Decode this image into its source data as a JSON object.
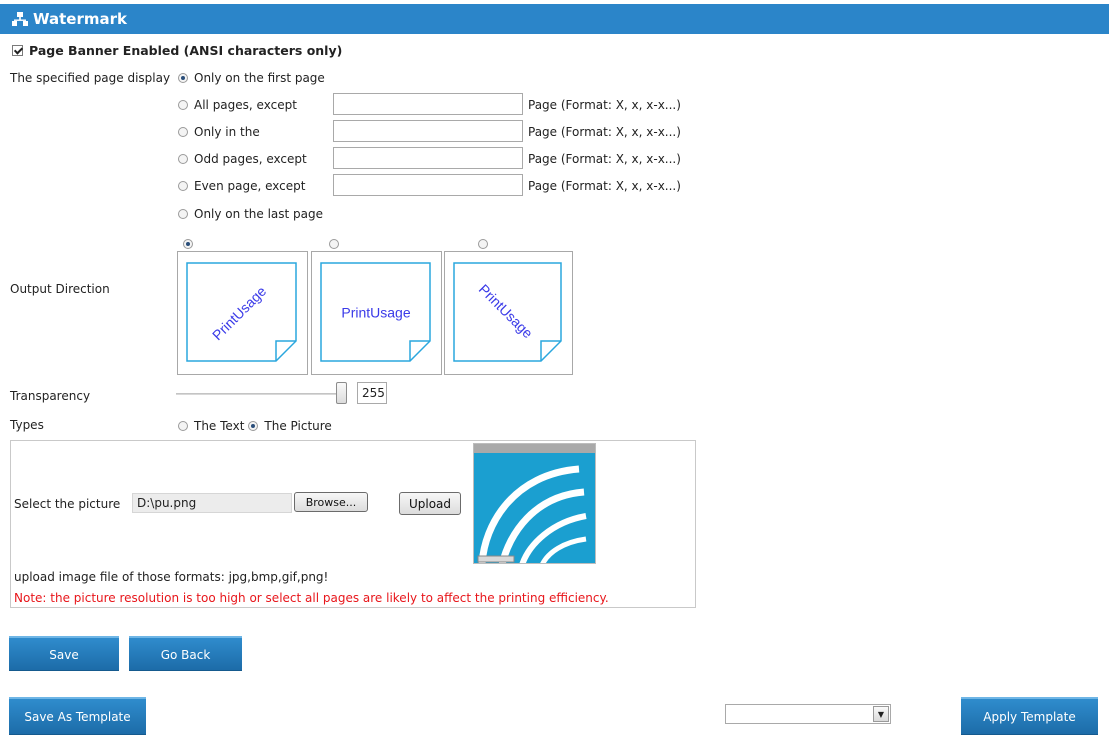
{
  "header": {
    "title": "Watermark",
    "icon": "network-icon",
    "bg_color": "#2b85c9"
  },
  "banner": {
    "label": "Page Banner Enabled (ANSI characters only)",
    "checked": true
  },
  "page_display": {
    "label": "The specified page display",
    "options": [
      {
        "label": "Only on the first page",
        "selected": true
      },
      {
        "label": "All pages, except",
        "input": "",
        "format": "Page (Format: X, x, x-x...)"
      },
      {
        "label": "Only in the",
        "input": "",
        "format": "Page (Format: X, x, x-x...)"
      },
      {
        "label": "Odd pages, except",
        "input": "",
        "format": "Page (Format: X, x, x-x...)"
      },
      {
        "label": "Even page, except",
        "input": "",
        "format": "Page (Format: X, x, x-x...)"
      },
      {
        "label": "Only on the last page"
      }
    ]
  },
  "output_direction": {
    "label": "Output Direction",
    "sample_text": "PrintUsage",
    "options": [
      {
        "orientation": "diagonal-up",
        "selected": true
      },
      {
        "orientation": "horizontal",
        "selected": false
      },
      {
        "orientation": "diagonal-down",
        "selected": false
      }
    ]
  },
  "transparency": {
    "label": "Transparency",
    "value": "255",
    "level": 1.0
  },
  "types": {
    "label": "Types",
    "options": [
      {
        "label": "The Text",
        "selected": false
      },
      {
        "label": "The Picture",
        "selected": true
      }
    ]
  },
  "picture": {
    "label": "Select the picture",
    "file_value": "D:\\pu.png",
    "browse_label": "Browse...",
    "upload_label": "Upload",
    "formats_text": "upload image file of those formats: jpg,bmp,gif,png!",
    "note_text": "Note: the picture resolution is too high or select all pages are likely to affect the printing efficiency.",
    "note_color": "#e8161b"
  },
  "buttons": {
    "save": "Save",
    "go_back": "Go Back",
    "save_template": "Save As Template",
    "apply_template": "Apply Template"
  },
  "template_select": {
    "value": ""
  }
}
